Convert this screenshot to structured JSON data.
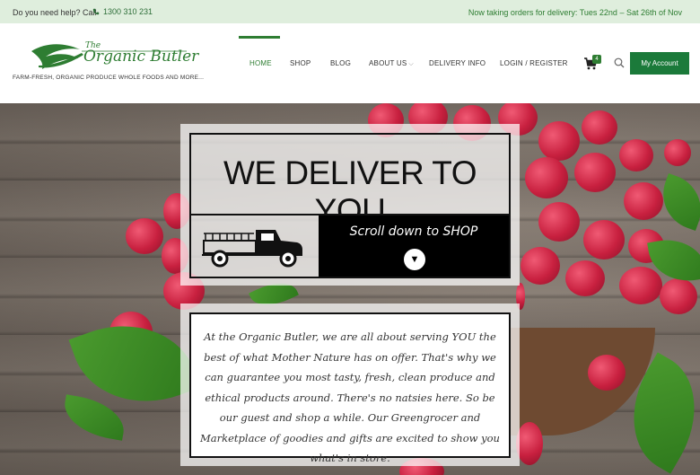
{
  "topbar": {
    "help_text": "Do you need help? Call",
    "phone": "1300 310 231",
    "notice": "Now taking orders for delivery: Tues 22nd – Sat 26th of Nov"
  },
  "brand": {
    "name_small": "The",
    "name_main": "Organic Butler",
    "tagline": "FARM-FRESH, ORGANIC PRODUCE WHOLE FOODS AND MORE...",
    "color": "#2e7d32"
  },
  "nav": {
    "items": [
      {
        "label": "HOME",
        "active": true
      },
      {
        "label": "SHOP"
      },
      {
        "label": "BLOG"
      },
      {
        "label": "ABOUT US"
      },
      {
        "label": "DELIVERY INFO"
      },
      {
        "label": "LOGIN / REGISTER"
      }
    ],
    "cart_count": "4",
    "account_label": "My Account"
  },
  "hero": {
    "headline": "WE DELIVER TO YOU",
    "scroll_label": "Scroll down to SHOP",
    "scroll_icon": "▼",
    "about_text": "At the Organic Butler, we are all about serving YOU the best of what Mother Nature has on offer. That's why we can guarantee you most tasty, fresh, clean produce and ethical products around. There's no natsies here. So be our guest and shop a while. Our Greengrocer and Marketplace of goodies and gifts are excited to show you what's in store."
  },
  "icons": {
    "phone": "phone-icon",
    "cart": "cart-icon",
    "search": "search-icon",
    "truck": "truck-icon",
    "caret": "chevron-down-icon"
  },
  "colors": {
    "accent": "#2e7d32",
    "button": "#1b7a3a",
    "topbar_bg": "#dfeedd"
  }
}
